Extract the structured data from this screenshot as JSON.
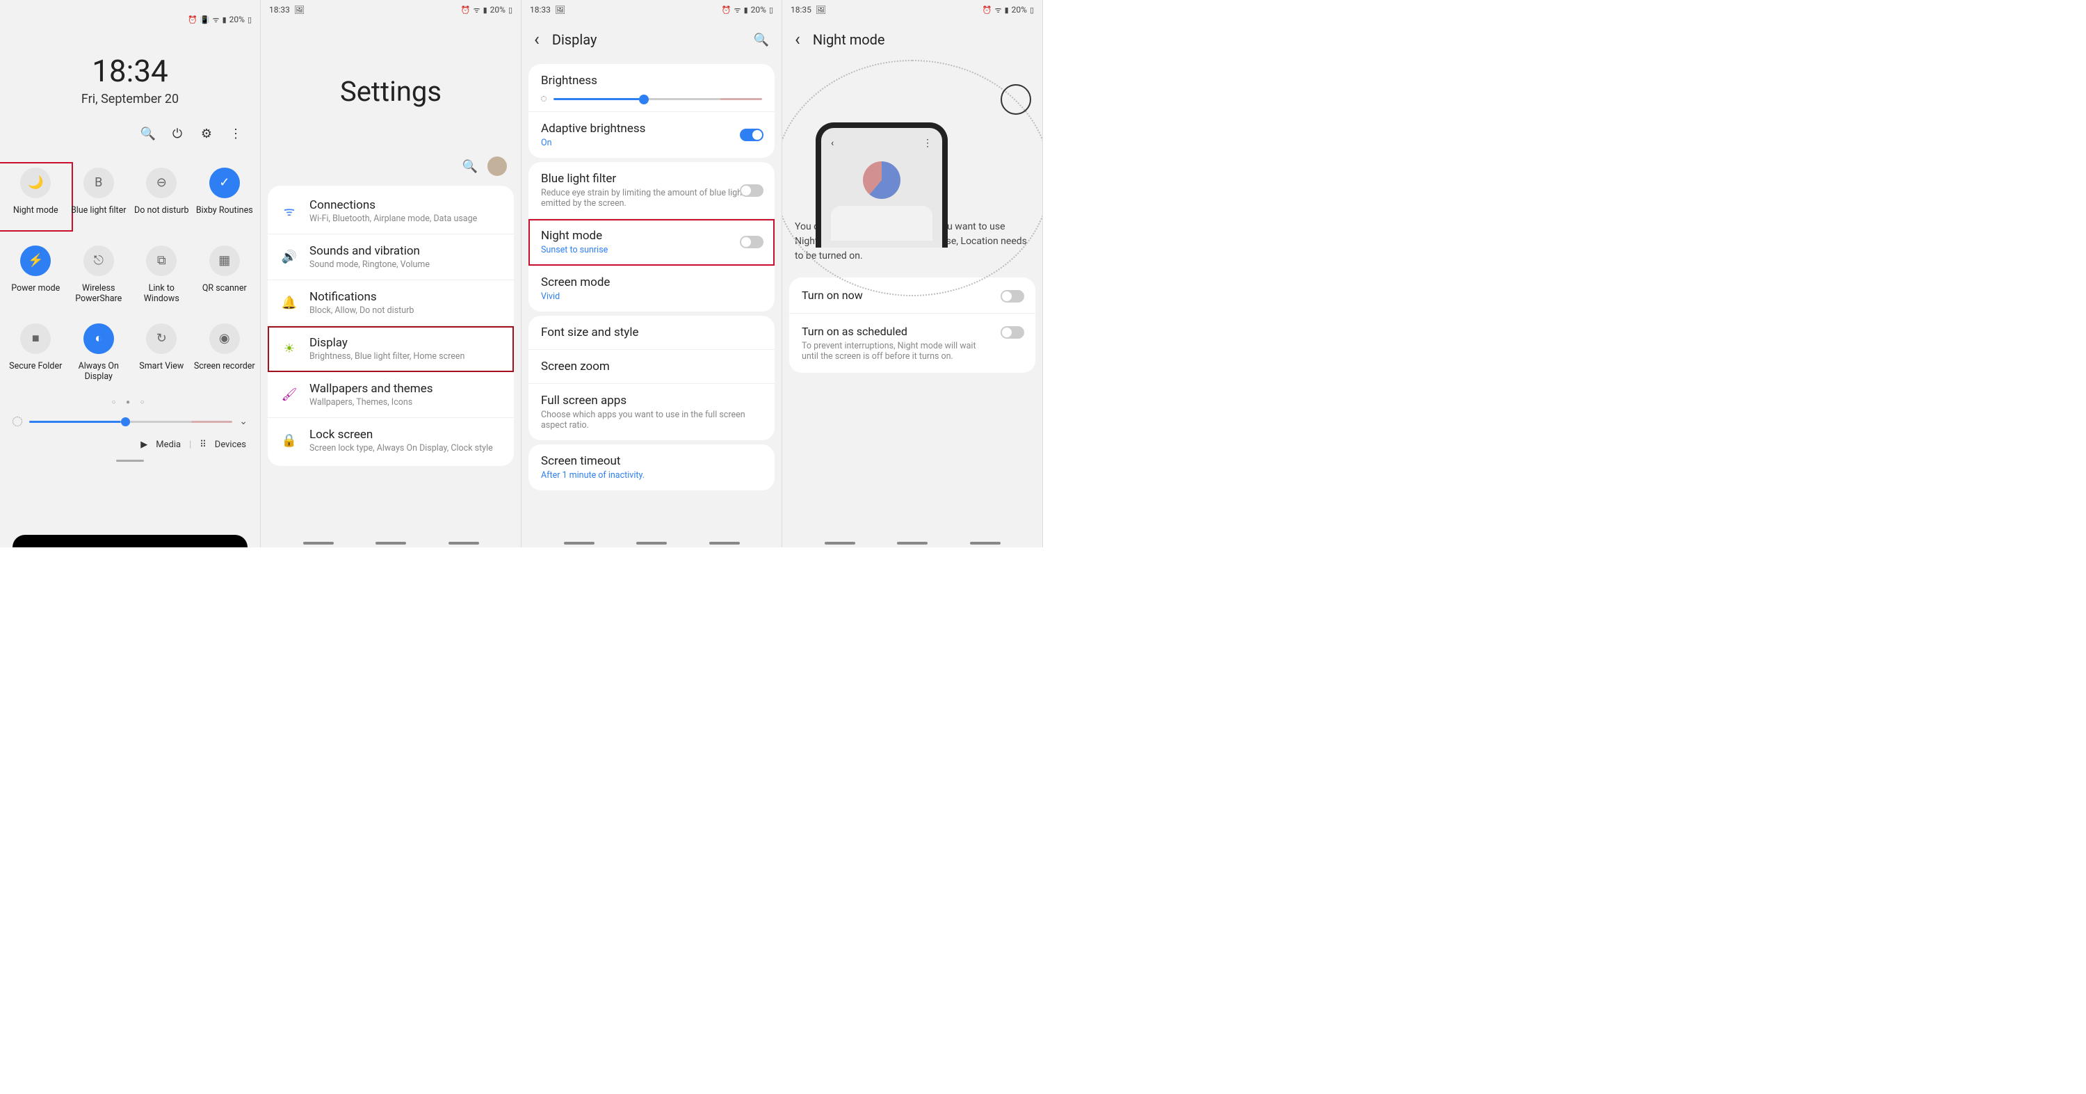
{
  "status": {
    "time1": "18:33",
    "time2": "18:33",
    "time3": "18:35",
    "battery": "20%"
  },
  "panel1": {
    "time": "18:34",
    "date": "Fri, September 20",
    "tiles": [
      {
        "label": "Night mode",
        "icon": "🌙",
        "on": false,
        "hl": true,
        "name": "tile-night-mode"
      },
      {
        "label": "Blue light filter",
        "icon": "B",
        "on": false,
        "hl": false,
        "name": "tile-blue-light"
      },
      {
        "label": "Do not disturb",
        "icon": "⊖",
        "on": false,
        "hl": false,
        "name": "tile-dnd"
      },
      {
        "label": "Bixby Routines",
        "icon": "✓",
        "on": true,
        "hl": false,
        "name": "tile-bixby"
      },
      {
        "label": "Power mode",
        "icon": "⚡",
        "on": true,
        "hl": false,
        "name": "tile-power"
      },
      {
        "label": "Wireless PowerShare",
        "icon": "⎋",
        "on": false,
        "hl": false,
        "name": "tile-powershare"
      },
      {
        "label": "Link to Windows",
        "icon": "⧉",
        "on": false,
        "hl": false,
        "name": "tile-link-windows"
      },
      {
        "label": "QR scanner",
        "icon": "▦",
        "on": false,
        "hl": false,
        "name": "tile-qr"
      },
      {
        "label": "Secure Folder",
        "icon": "■",
        "on": false,
        "hl": false,
        "name": "tile-secure-folder"
      },
      {
        "label": "Always On Display",
        "icon": "◐",
        "on": true,
        "hl": false,
        "name": "tile-aod"
      },
      {
        "label": "Smart View",
        "icon": "↻",
        "on": false,
        "hl": false,
        "name": "tile-smartview"
      },
      {
        "label": "Screen recorder",
        "icon": "◉",
        "on": false,
        "hl": false,
        "name": "tile-recorder"
      }
    ],
    "media": "Media",
    "devices": "Devices"
  },
  "panel2": {
    "title": "Settings",
    "rows": [
      {
        "title": "Connections",
        "sub": "Wi-Fi, Bluetooth, Airplane mode, Data usage",
        "icon": "ᯤ",
        "color": "#3a86ff",
        "name": "row-connections",
        "hl": false
      },
      {
        "title": "Sounds and vibration",
        "sub": "Sound mode, Ringtone, Volume",
        "icon": "🔊",
        "color": "#8a5cf6",
        "name": "row-sounds",
        "hl": false
      },
      {
        "title": "Notifications",
        "sub": "Block, Allow, Do not disturb",
        "icon": "🔔",
        "color": "#e76f51",
        "name": "row-notifications",
        "hl": false
      },
      {
        "title": "Display",
        "sub": "Brightness, Blue light filter, Home screen",
        "icon": "☀",
        "color": "#7fb800",
        "name": "row-display",
        "hl": true
      },
      {
        "title": "Wallpapers and themes",
        "sub": "Wallpapers, Themes, Icons",
        "icon": "🖌",
        "color": "#b5179e",
        "name": "row-wallpapers",
        "hl": false
      },
      {
        "title": "Lock screen",
        "sub": "Screen lock type, Always On Display, Clock style",
        "icon": "🔒",
        "color": "#7b61ff",
        "name": "row-lockscreen",
        "hl": false
      }
    ]
  },
  "panel3": {
    "title": "Display",
    "brightness_label": "Brightness",
    "adaptive_label": "Adaptive brightness",
    "adaptive_value": "On",
    "blf_label": "Blue light filter",
    "blf_sub": "Reduce eye strain by limiting the amount of blue light emitted by the screen.",
    "night_label": "Night mode",
    "night_sub": "Sunset to sunrise",
    "screenmode_label": "Screen mode",
    "screenmode_value": "Vivid",
    "font_label": "Font size and style",
    "zoom_label": "Screen zoom",
    "full_label": "Full screen apps",
    "full_sub": "Choose which apps you want to use in the full screen aspect ratio.",
    "timeout_label": "Screen timeout",
    "timeout_value": "After 1 minute of inactivity."
  },
  "panel4": {
    "title": "Night mode",
    "desc": "You can set a schedule for when you want to use Night mode. To use Sunset to sunrise, Location needs to be turned on.",
    "turn_on_now": "Turn on now",
    "scheduled": "Turn on as scheduled",
    "scheduled_sub": "To prevent interruptions, Night mode will wait until the screen is off before it turns on."
  }
}
